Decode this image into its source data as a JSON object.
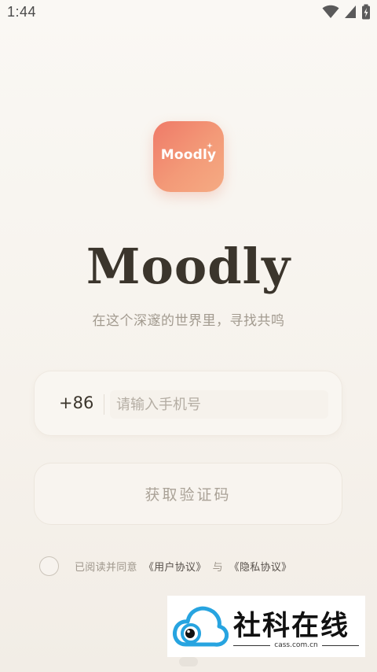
{
  "status_bar": {
    "time": "1:44",
    "icons": [
      "wifi-icon",
      "cellular-signal-icon",
      "battery-charging-icon"
    ]
  },
  "app": {
    "icon_text": "Moodly",
    "title": "Moodly",
    "subtitle": "在这个深邃的世界里，寻找共鸣"
  },
  "login": {
    "country_code": "+86",
    "phone_placeholder": "请输入手机号",
    "phone_value": "",
    "get_code_label": "获取验证码"
  },
  "agreement": {
    "checked": false,
    "prefix": "已阅读并同意",
    "user_agreement": "《用户协议》",
    "conjunction": "与",
    "privacy_policy": "《隐私协议》"
  },
  "watermark": {
    "title": "社科在线",
    "domain": "cass.com.cn"
  },
  "colors": {
    "accent_start": "#ef7a68",
    "accent_end": "#f5ab83",
    "title": "#3b352c",
    "muted_text": "#a29a8f",
    "background": "#faf8f4",
    "watermark_blue": "#27a4e0"
  }
}
